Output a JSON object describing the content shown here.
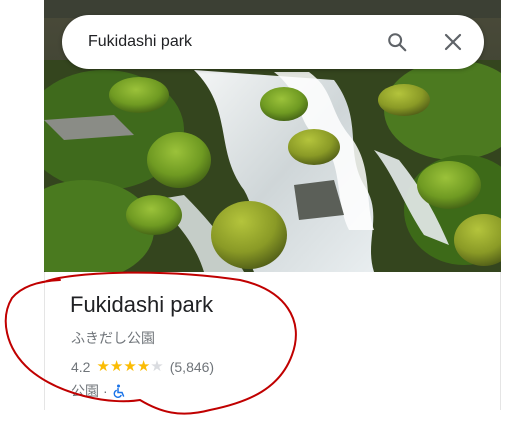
{
  "search": {
    "query": "Fukidashi park"
  },
  "icons": {
    "search": "search-icon",
    "close": "close-icon",
    "wheelchair": "wheelchair-accessible-icon"
  },
  "place": {
    "title": "Fukidashi park",
    "subtitle": "ふきだし公園",
    "rating": "4.2",
    "rating_stars": 4.2,
    "review_count": "(5,846)",
    "category": "公園",
    "separator": "·"
  },
  "colors": {
    "star": "#fbbc04",
    "accessibility_icon": "#1a73e8",
    "annotation": "#c00000"
  }
}
